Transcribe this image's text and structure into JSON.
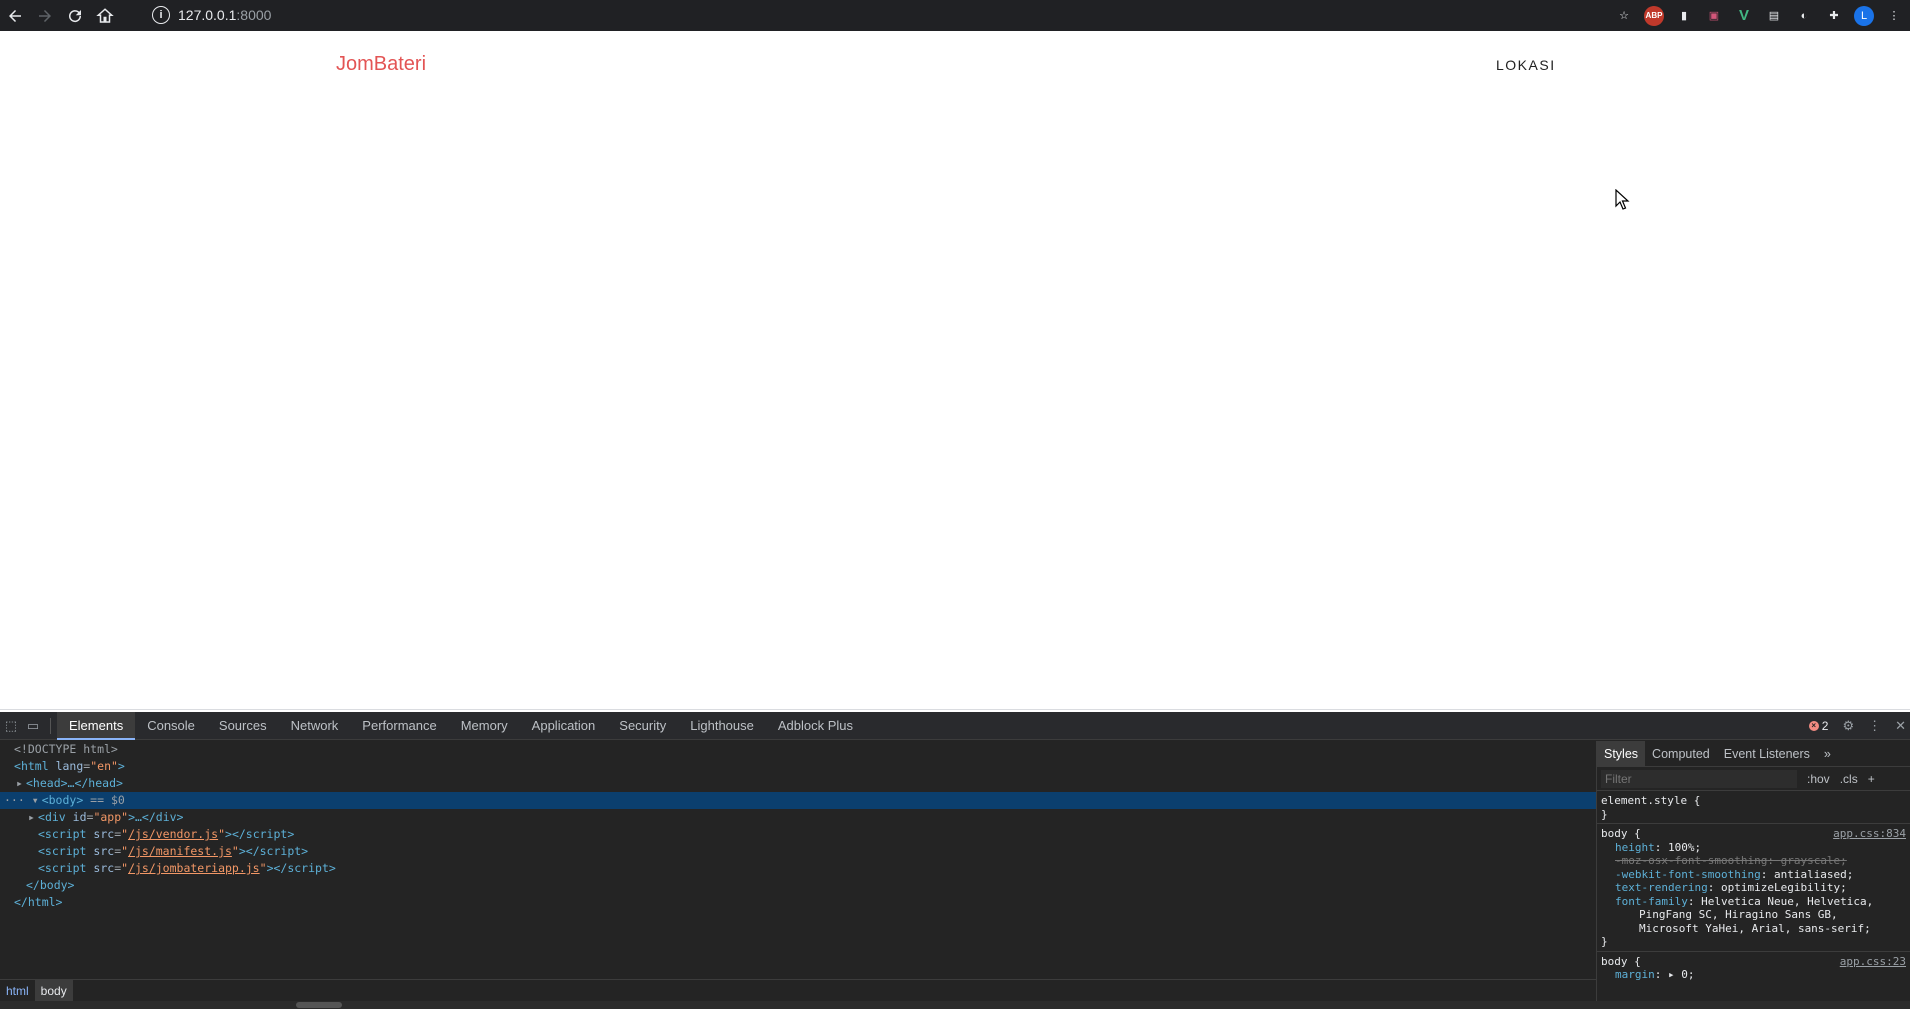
{
  "browser": {
    "url_host": "127.0.0.1",
    "url_port": ":8000",
    "extensions": [
      "ABP",
      "V"
    ],
    "profile_initial": "L"
  },
  "page": {
    "brand": "JomBateri",
    "nav_link": "LOKASI"
  },
  "devtools": {
    "tabs": [
      "Elements",
      "Console",
      "Sources",
      "Network",
      "Performance",
      "Memory",
      "Application",
      "Security",
      "Lighthouse",
      "Adblock Plus"
    ],
    "error_count": "2",
    "dom": {
      "doctype": "<!DOCTYPE html>",
      "html_open_tag": "html",
      "html_lang_attr": "lang",
      "html_lang_val": "\"en\"",
      "head": "<head>…</head>",
      "body_tag": "<body>",
      "body_marker": " == $0",
      "div_tag": "div",
      "div_attr": "id",
      "div_val": "\"app\"",
      "div_rest": ">…</div>",
      "scripts": [
        {
          "src": "/js/vendor.js"
        },
        {
          "src": "/js/manifest.js"
        },
        {
          "src": "/js/jombateriapp.js"
        }
      ],
      "body_close": "</body>",
      "html_close": "</html>"
    },
    "breadcrumbs": [
      "html",
      "body"
    ],
    "styles_tabs": [
      "Styles",
      "Computed",
      "Event Listeners"
    ],
    "filter_placeholder": "Filter",
    "hov": ":hov",
    "cls": ".cls",
    "element_style": "element.style {",
    "rule1": {
      "selector": "body {",
      "source": "app.css:834",
      "props": [
        {
          "name": "height",
          "value": "100%;",
          "struck": false
        },
        {
          "name": "-moz-osx-font-smoothing",
          "value": "grayscale;",
          "struck": true
        },
        {
          "name": "-webkit-font-smoothing",
          "value": "antialiased;",
          "struck": false
        },
        {
          "name": "text-rendering",
          "value": "optimizeLegibility;",
          "struck": false
        },
        {
          "name": "font-family",
          "value": "Helvetica Neue, Helvetica,",
          "struck": false
        }
      ],
      "font_cont1": "PingFang SC, Hiragino Sans GB,",
      "font_cont2": "Microsoft YaHei, Arial, sans-serif;"
    },
    "rule2": {
      "selector": "body {",
      "source": "app.css:23",
      "prop_name": "margin",
      "prop_value": "▸ 0;"
    }
  }
}
